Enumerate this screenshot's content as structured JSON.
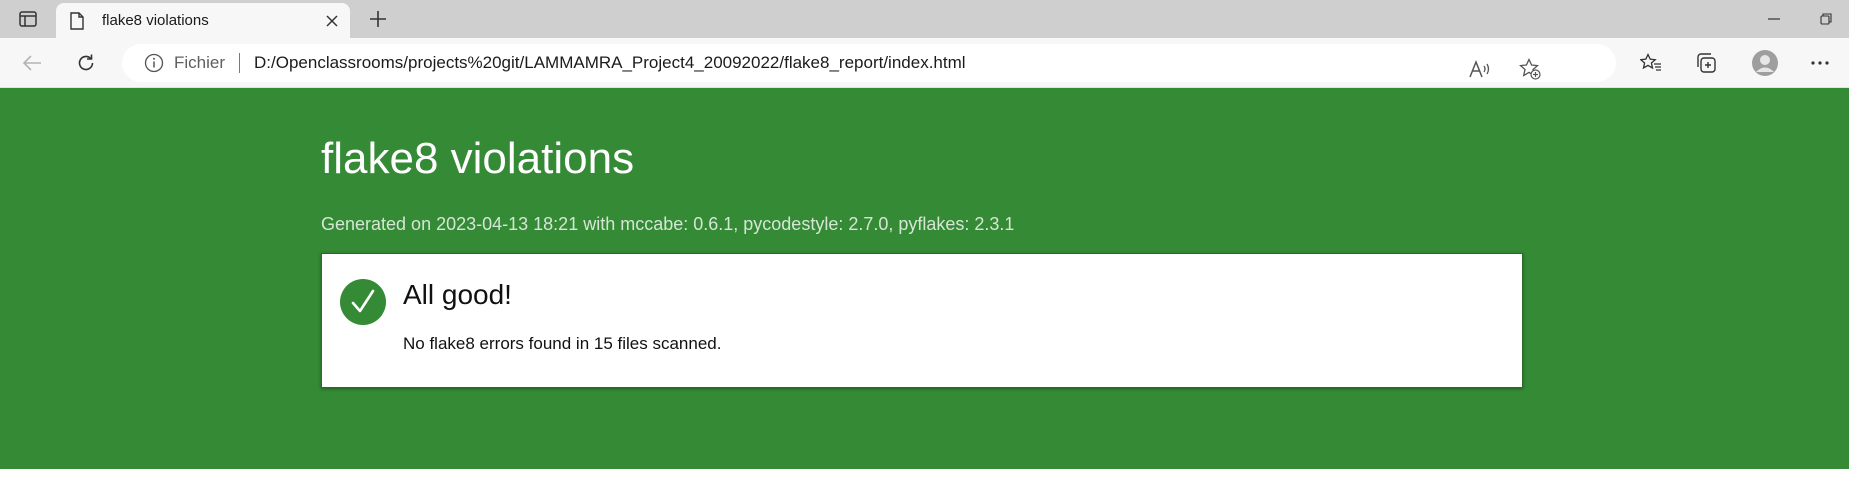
{
  "browser": {
    "tab": {
      "title": "flake8 violations"
    },
    "address": {
      "scheme_label": "Fichier",
      "url": "D:/Openclassrooms/projects%20git/LAMMAMRA_Project4_20092022/flake8_report/index.html"
    },
    "icons": {
      "tab_actions": "tab-actions-icon",
      "page": "page-icon",
      "close": "close-icon",
      "new_tab": "plus-icon",
      "back": "back-arrow-icon",
      "refresh": "refresh-icon",
      "info": "info-icon",
      "read_aloud": "read-aloud-icon",
      "add_favorite": "add-favorite-icon",
      "favorites": "favorites-icon",
      "collections": "collections-icon",
      "profile": "profile-avatar-icon",
      "more": "more-icon",
      "minimize": "minimize-icon",
      "restore": "restore-icon"
    }
  },
  "report": {
    "title": "flake8 violations",
    "generated": "Generated on 2023-04-13 18:21 with mccabe: 0.6.1, pycodestyle: 2.7.0, pyflakes: 2.3.1",
    "status": {
      "icon": "checkmark-icon",
      "heading": "All good!",
      "message": "No flake8 errors found in 15 files scanned."
    }
  },
  "colors": {
    "banner_green": "#348a35",
    "card_background": "#ffffff",
    "tab_strip": "#cfcfcf",
    "toolbar": "#f7f7f7"
  }
}
